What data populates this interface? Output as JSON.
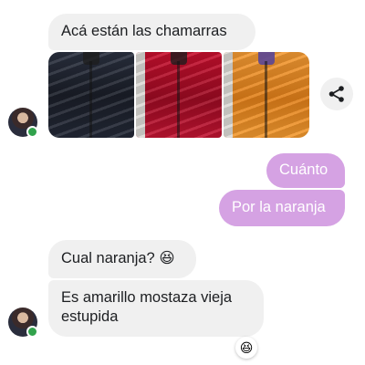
{
  "messages": [
    {
      "text": "Acá están las chamarras",
      "direction": "received"
    },
    {
      "text": "Cuánto",
      "direction": "sent"
    },
    {
      "text": "Por la naranja",
      "direction": "sent"
    },
    {
      "text": "Cual naranja? 😆",
      "direction": "received"
    },
    {
      "text": "Es amarillo mostaza vieja estupida",
      "direction": "received"
    }
  ],
  "photos": [
    {
      "subject": "dark jacket",
      "color": "#232836"
    },
    {
      "subject": "red jacket",
      "color": "#b50f2b"
    },
    {
      "subject": "orange jacket",
      "color": "#ef8f27"
    }
  ],
  "reaction": {
    "emoji": "😆"
  },
  "theme": {
    "received_bubble": "#f0f0f0",
    "sent_bubble": "#d5a2e3",
    "online_dot": "#31a24c"
  },
  "icons": {
    "share": "share-icon",
    "online": "online-status-icon"
  }
}
